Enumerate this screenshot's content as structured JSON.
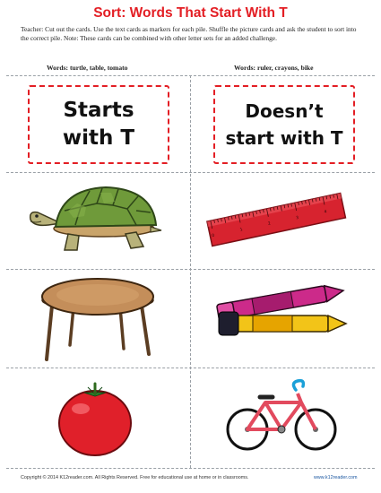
{
  "header": {
    "title": "Sort: Words That Start With T",
    "instructions": "Teacher: Cut out the cards. Use the text cards as markers for each pile. Shuffle the picture cards and ask the student to sort into the correct pile.  Note: These cards can be combined with other letter sets for an added challenge."
  },
  "columns": {
    "left_words": "Words: turtle, table, tomato",
    "right_words": "Words: ruler, crayons, bike"
  },
  "cards": {
    "starts_line1": "Starts",
    "starts_line2": "with T",
    "doesnt_line1": "Doesn’t",
    "doesnt_line2": "start with T"
  },
  "pictures": [
    {
      "name": "turtle",
      "icon": "turtle-icon"
    },
    {
      "name": "ruler",
      "icon": "ruler-icon"
    },
    {
      "name": "table",
      "icon": "table-icon"
    },
    {
      "name": "crayons",
      "icon": "crayons-icon"
    },
    {
      "name": "tomato",
      "icon": "tomato-icon"
    },
    {
      "name": "bike",
      "icon": "bike-icon"
    }
  ],
  "ruler_numbers": [
    "0",
    "1",
    "2",
    "3",
    "4"
  ],
  "footer": {
    "copyright": "Copyright © 2014  K12reader.com. All Rights Reserved. Free for educational use at home or in classrooms.",
    "site": "www.k12reader.com"
  },
  "colors": {
    "title": "#e31e24",
    "card_border": "#e31e24",
    "cut_lines": "#9aa0a6",
    "site_link": "#1a56a0"
  }
}
